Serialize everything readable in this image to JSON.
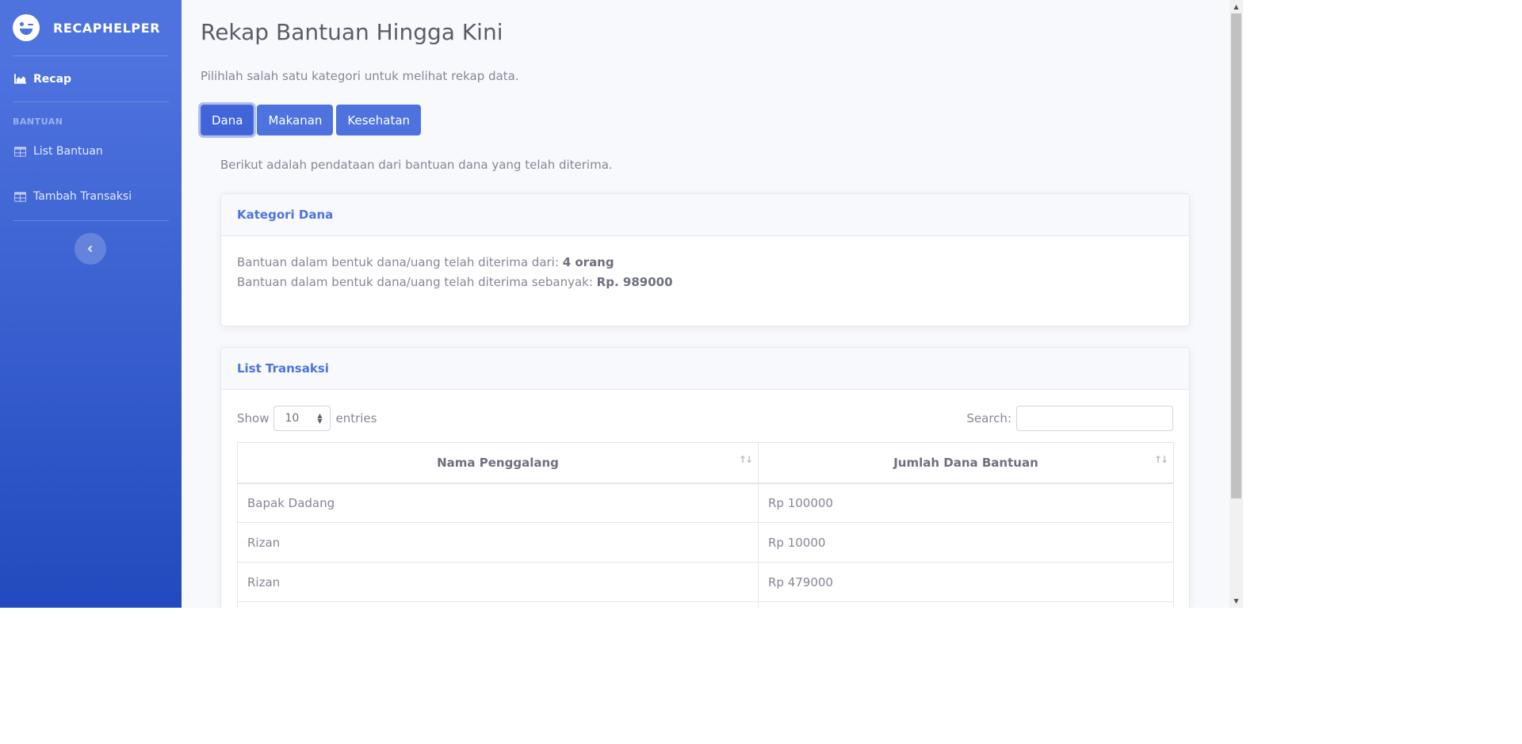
{
  "sidebar": {
    "brand": "RECAPHELPER",
    "nav_recap": "Recap",
    "heading": "BANTUAN",
    "nav_list_bantuan": "List Bantuan",
    "nav_tambah_transaksi": "Tambah Transaksi",
    "brand_icon": "laugh-wink-icon",
    "toggle_icon": "chevron-left-icon"
  },
  "page": {
    "title": "Rekap Bantuan Hingga Kini",
    "description": "Pilihlah salah satu kategori untuk melihat rekap data."
  },
  "categories": {
    "dana": "Dana",
    "makanan": "Makanan",
    "kesehatan": "Kesehatan",
    "selected": "Dana"
  },
  "info_text": "Berikut adalah pendataan dari bantuan dana yang telah diterima.",
  "summary_card": {
    "title": "Kategori Dana",
    "line1_label": "Bantuan dalam bentuk dana/uang telah diterima dari:",
    "line1_value": "4 orang",
    "line2_label": "Bantuan dalam bentuk dana/uang telah diterima sebanyak:",
    "line2_value": "Rp. 989000"
  },
  "transactions_card": {
    "title": "List Transaksi",
    "show_label": "Show",
    "entries_value": "10",
    "entries_label": "entries",
    "search_label": "Search:",
    "columns": [
      "Nama Penggalang",
      "Jumlah Dana Bantuan"
    ],
    "rows": [
      [
        "Bapak Dadang",
        "Rp 100000"
      ],
      [
        "Rizan",
        "Rp 10000"
      ],
      [
        "Rizan",
        "Rp 479000"
      ]
    ]
  },
  "colors": {
    "primary": "#4e73df",
    "sidebar_gradient_end": "#224abe",
    "text": "#858796",
    "title": "#5a5c69"
  }
}
